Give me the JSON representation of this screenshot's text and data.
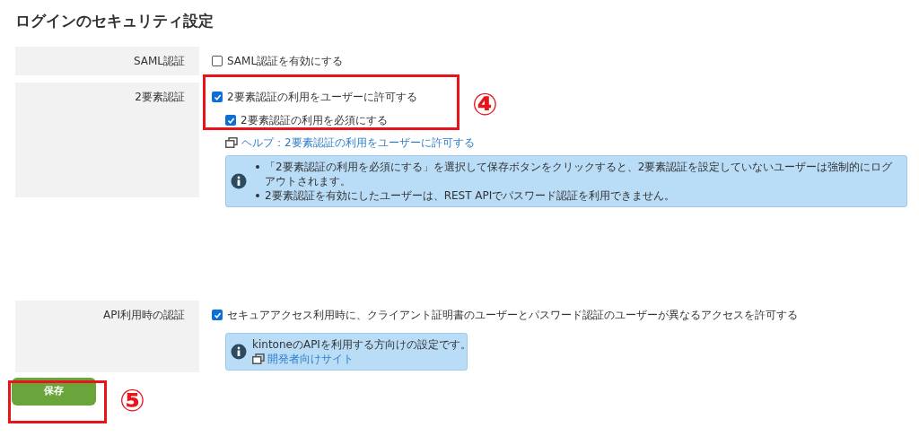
{
  "title": "ログインのセキュリティ設定",
  "sections": [
    {
      "label": "SAML認証",
      "options": [
        {
          "label": "SAML認証を有効にする",
          "checked": false
        }
      ]
    },
    {
      "label": "2要素認証",
      "options": [
        {
          "label": "2要素認証の利用をユーザーに許可する",
          "checked": true,
          "children": [
            {
              "label": "2要素認証の利用を必須にする",
              "checked": true
            }
          ]
        }
      ],
      "help_link": "ヘルプ：2要素認証の利用をユーザーに許可する",
      "info": {
        "kind": "list",
        "items": [
          "「2要素認証の利用を必須にする」を選択して保存ボタンをクリックすると、2要素認証を設定していないユーザーは強制的にログアウトされます。",
          "2要素認証を有効にしたユーザーは、REST APIでパスワード認証を利用できません。"
        ]
      }
    },
    {
      "label": "API利用時の認証",
      "options": [
        {
          "label": "セキュアアクセス利用時に、クライアント証明書のユーザーとパスワード認証のユーザーが異なるアクセスを許可する",
          "checked": true
        }
      ],
      "info": {
        "kind": "text",
        "text": "kintoneのAPIを利用する方向けの設定です。",
        "link": "開発者向けサイト"
      }
    }
  ],
  "save_button": "保存",
  "callouts": [
    {
      "number": "④"
    },
    {
      "number": "⑤"
    }
  ]
}
